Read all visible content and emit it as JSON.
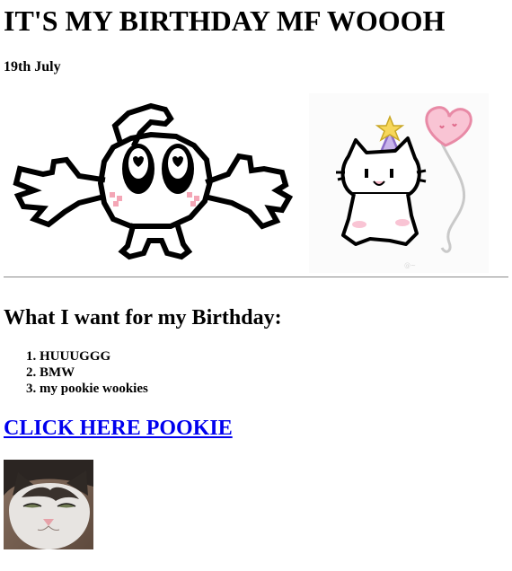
{
  "page": {
    "title": "IT'S MY BIRTHDAY MF WOOOH",
    "date": "19th July"
  },
  "wishlist": {
    "heading": "What I want for my Birthday:",
    "items": [
      {
        "label": "HUUUGGG"
      },
      {
        "label": "BMW"
      },
      {
        "label": "my pookie wookies"
      }
    ]
  },
  "link": {
    "label": "CLICK HERE POOKIE",
    "color": "#0000ee"
  },
  "images": {
    "hug_creature": "pixel-art-hugging-creature-image",
    "party_cat": "party-hat-cat-with-heart-balloon-image",
    "cat_photo": "smug-cat-photo-image"
  }
}
